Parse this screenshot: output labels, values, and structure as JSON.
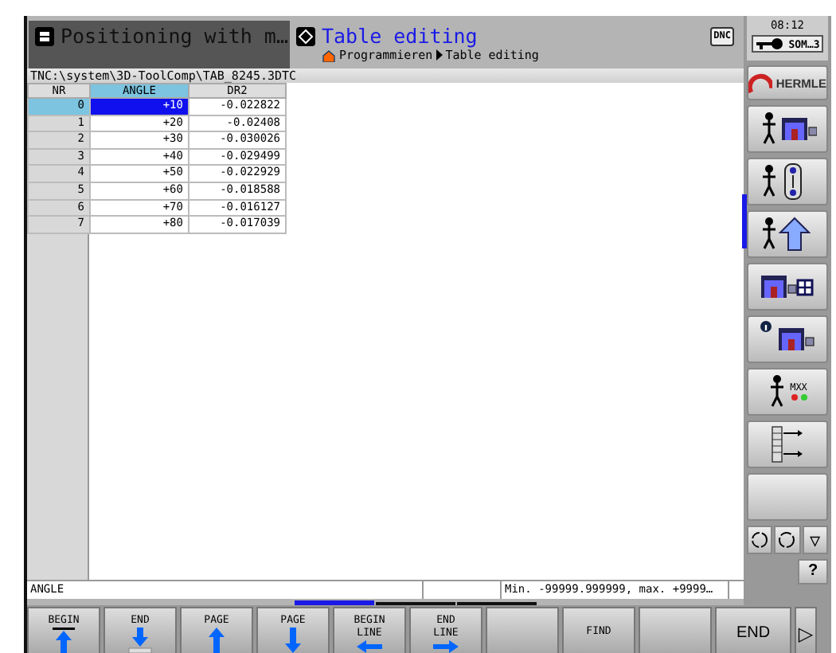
{
  "header": {
    "modes": [
      {
        "label": "Positioning with m…",
        "selected": false,
        "kind": "machine"
      },
      {
        "label": "Table editing",
        "selected": true,
        "kind": "program"
      }
    ],
    "breadcrumb": [
      "Programmieren",
      "Table editing"
    ],
    "dnc": "DNC",
    "clock": "08:12",
    "user": "SOM…3"
  },
  "file_path": "TNC:\\system\\3D-ToolComp\\TAB_8245.3DTC",
  "table": {
    "columns": [
      {
        "label": "NR",
        "selected": false
      },
      {
        "label": "ANGLE",
        "selected": true
      },
      {
        "label": "DR2",
        "selected": false
      }
    ],
    "rows": [
      {
        "cells": [
          "0",
          "+10",
          "-0.022822"
        ],
        "selected": true
      },
      {
        "cells": [
          "1",
          "+20",
          "-0.02408"
        ],
        "selected": false
      },
      {
        "cells": [
          "2",
          "+30",
          "-0.030026"
        ],
        "selected": false
      },
      {
        "cells": [
          "3",
          "+40",
          "-0.029499"
        ],
        "selected": false
      },
      {
        "cells": [
          "4",
          "+50",
          "-0.022929"
        ],
        "selected": false
      },
      {
        "cells": [
          "5",
          "+60",
          "-0.018588"
        ],
        "selected": false
      },
      {
        "cells": [
          "6",
          "+70",
          "-0.016127"
        ],
        "selected": false
      },
      {
        "cells": [
          "7",
          "+80",
          "-0.017039"
        ],
        "selected": false
      }
    ]
  },
  "status_bar": {
    "field": "ANGLE",
    "range": "Min. -99999.999999, max. +9999…"
  },
  "sidebar": {
    "logo": "HERMLE",
    "buttons": [
      {
        "kind": "machine"
      },
      {
        "kind": "door"
      },
      {
        "kind": "arrow"
      },
      {
        "kind": "grid"
      },
      {
        "kind": "info"
      },
      {
        "kind": "mxx",
        "label": "MXX"
      },
      {
        "kind": "list"
      },
      {
        "kind": "blank"
      }
    ],
    "tools": [
      {
        "kind": "rotate-left"
      },
      {
        "kind": "rotate-right"
      },
      {
        "kind": "triangle",
        "label": "▽"
      }
    ],
    "help": "?"
  },
  "softkey_pages": [
    {
      "selected": true
    },
    {
      "selected": false
    },
    {
      "selected": false
    }
  ],
  "softkeys": [
    {
      "lines": [
        "BEGIN"
      ],
      "kind": "top"
    },
    {
      "lines": [
        "END"
      ],
      "kind": "bottom"
    },
    {
      "lines": [
        "PAGE"
      ],
      "kind": "up"
    },
    {
      "lines": [
        "PAGE"
      ],
      "kind": "down"
    },
    {
      "lines": [
        "BEGIN",
        "LINE"
      ],
      "kind": "left"
    },
    {
      "lines": [
        "END",
        "LINE"
      ],
      "kind": "right"
    },
    {
      "kind": "blank"
    },
    {
      "lines": [
        "FIND"
      ],
      "kind": "text"
    },
    {
      "kind": "blank"
    }
  ],
  "end_key": "END",
  "next_key": "▷"
}
